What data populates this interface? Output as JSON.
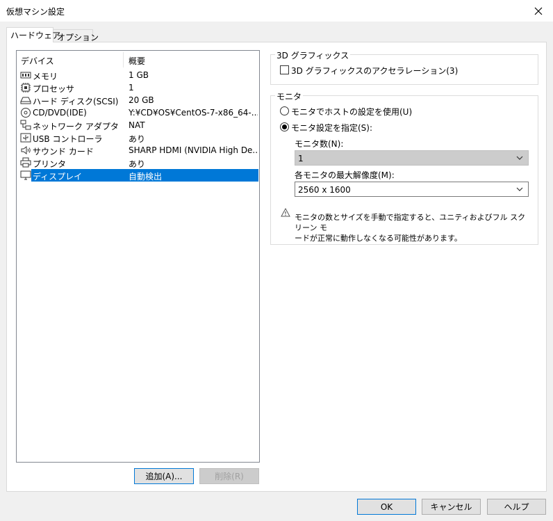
{
  "window": {
    "title": "仮想マシン設定"
  },
  "tabs": [
    {
      "label": "ハードウェア",
      "active": true
    },
    {
      "label": "オプション",
      "active": false
    }
  ],
  "device_list": {
    "col_device": "デバイス",
    "col_summary": "概要",
    "items": [
      {
        "name": "メモリ",
        "value": "1 GB",
        "icon": "memory-icon"
      },
      {
        "name": "プロセッサ",
        "value": "1",
        "icon": "processor-icon"
      },
      {
        "name": "ハード ディスク(SCSI)",
        "value": "20 GB",
        "icon": "hard-disk-icon"
      },
      {
        "name": "CD/DVD(IDE)",
        "value": "Y:¥CD¥OS¥CentOS-7-x86_64-...",
        "icon": "cd-dvd-icon"
      },
      {
        "name": "ネットワーク アダプタ",
        "value": "NAT",
        "icon": "network-icon"
      },
      {
        "name": "USB コントローラ",
        "value": "あり",
        "icon": "usb-icon"
      },
      {
        "name": "サウンド カード",
        "value": "SHARP HDMI (NVIDIA High De...",
        "icon": "speaker-icon"
      },
      {
        "name": "プリンタ",
        "value": "あり",
        "icon": "printer-icon"
      },
      {
        "name": "ディスプレイ",
        "value": "自動検出",
        "icon": "monitor-icon",
        "selected": true
      }
    ]
  },
  "buttons": {
    "add": "追加(A)...",
    "remove": "削除(R)",
    "ok": "OK",
    "cancel": "キャンセル",
    "help": "ヘルプ"
  },
  "graphics_3d": {
    "group_label": "3D グラフィックス",
    "accel_label": "3D グラフィックスのアクセラレーション(3)",
    "accel_checked": false
  },
  "monitor": {
    "group_label": "モニタ",
    "use_host_label": "モニタでホストの設定を使用(U)",
    "specify_label": "モニタ設定を指定(S):",
    "specify_selected": true,
    "count_label": "モニタ数(N):",
    "count_value": "1",
    "resolution_label": "各モニタの最大解像度(M):",
    "resolution_value": "2560 x 1600",
    "warning_line1": "モニタの数とサイズを手動で指定すると、ユニティおよびフル スクリーン モ",
    "warning_line2": "ードが正常に動作しなくなる可能性があります。"
  },
  "colors": {
    "selection": "#0078d7",
    "accent_border": "#0078d7"
  }
}
